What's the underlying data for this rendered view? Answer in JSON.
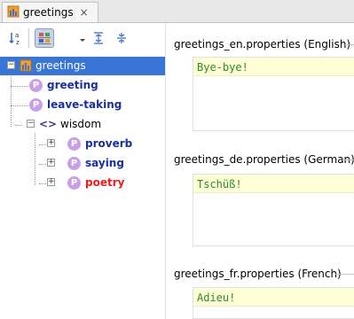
{
  "tab": {
    "label": "greetings",
    "close": "×"
  },
  "toolbar": {
    "sort_icon_top": "a",
    "sort_icon_bottom": "z"
  },
  "tree": {
    "root": {
      "label": "greetings"
    },
    "items": [
      {
        "label": "greeting",
        "badge": "P"
      },
      {
        "label": "leave-taking",
        "badge": "P"
      },
      {
        "label": "wisdom",
        "icon": "<>"
      },
      {
        "label": "proverb",
        "badge": "P"
      },
      {
        "label": "saying",
        "badge": "P"
      },
      {
        "label": "poetry",
        "badge": "P"
      }
    ],
    "colors": {
      "selected_bg": "#3875d7",
      "key_blue": "#1a2e9e",
      "key_red": "#ee1b1b",
      "badge": "#c9a0e8"
    }
  },
  "panels": [
    {
      "header": "greetings_en.properties (English)",
      "value": "Bye-bye!"
    },
    {
      "header": "greetings_de.properties (German)",
      "value": "Tschüß!"
    },
    {
      "header": "greetings_fr.properties (French)",
      "value": "Adieu!"
    }
  ],
  "colors": {
    "value_text": "#2e8b2e",
    "editor_line_bg": "#fdfdd6"
  }
}
